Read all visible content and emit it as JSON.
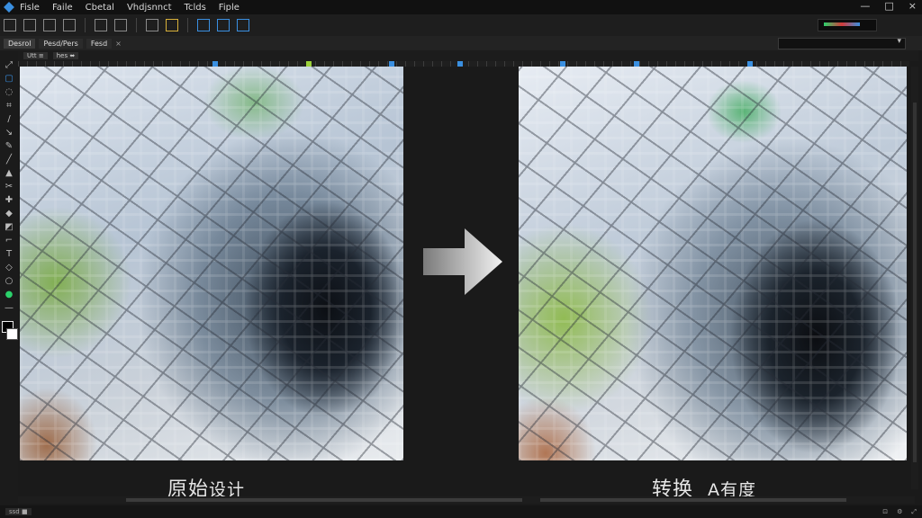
{
  "menu": {
    "items": [
      "Fisle",
      "Faile",
      "Cbetal",
      "Vhdjsnnct",
      "Tclds",
      "Fiple"
    ],
    "window_controls": [
      "—",
      "□",
      "×"
    ]
  },
  "tabs": {
    "items": [
      "Desrol",
      "Pesd/Pers",
      "Fesd"
    ],
    "close": "×"
  },
  "subtabs": {
    "items": [
      "Utt ≡",
      "hes ⬌"
    ]
  },
  "captions": {
    "left": {
      "main": "原始",
      "small": "设计"
    },
    "right": {
      "main": "转换",
      "small": "A有度"
    }
  },
  "status": {
    "zoom": "ssd ■"
  },
  "colors": {
    "accent": "#3a8fe0",
    "panel": "#1a1a1a"
  }
}
